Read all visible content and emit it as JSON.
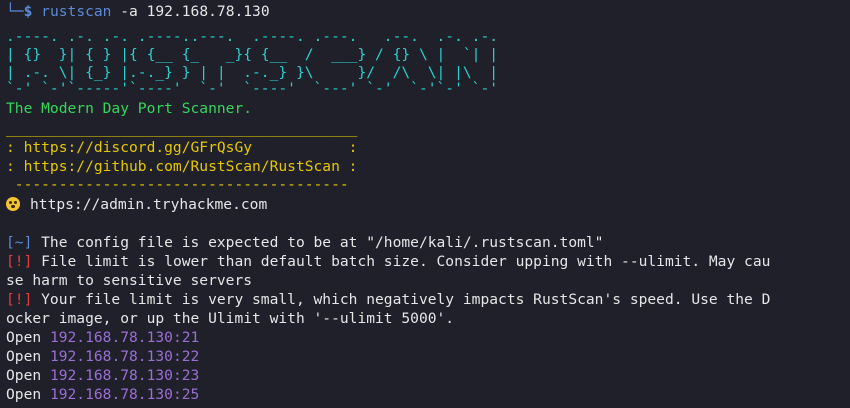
{
  "prompt": {
    "corner": "└─",
    "dollar": "$",
    "command": "rustscan",
    "args": " -a 192.168.78.130"
  },
  "logo": {
    "lines": [
      ".----. .-. .-. .----..---.  .----. .---.   .--.  .-. .-.",
      "| {}  }| { } |{ {__ {_   _}{ {__  /  ___} / {} \\ |  `| |",
      "| .-. \\| {_} |.-._} } | |  .-._} }\\     }/  /\\  \\| |\\  |",
      "`-' `-'`-----'`----'  `-'  `----'  `---' `-'  `-'`-' `-'"
    ]
  },
  "tagline": "The Modern Day Port Scanner.",
  "banner": {
    "top_rule": "________________________________________",
    "discord": ": https://discord.gg/GFrQsGy           :",
    "github": ": https://github.com/RustScan/RustScan :",
    "bottom_rule": " --------------------------------------"
  },
  "admin": {
    "icon": "surprised-face-emoji",
    "text": "https://admin.tryhackme.com"
  },
  "messages": [
    {
      "tag": "[~]",
      "tag_color": "blue",
      "text": " The config file is expected to be at \"/home/kali/.rustscan.toml\""
    },
    {
      "tag": "[!]",
      "tag_color": "red",
      "text": " File limit is lower than default batch size. Consider upping with --ulimit. May cau"
    },
    {
      "tag": "",
      "tag_color": "none",
      "text": "se harm to sensitive servers"
    },
    {
      "tag": "[!]",
      "tag_color": "red",
      "text": " Your file limit is very small, which negatively impacts RustScan's speed. Use the D"
    },
    {
      "tag": "",
      "tag_color": "none",
      "text": "ocker image, or up the Ulimit with '--ulimit 5000'."
    }
  ],
  "open_ports": [
    {
      "label": "Open ",
      "addr": "192.168.78.130:21"
    },
    {
      "label": "Open ",
      "addr": "192.168.78.130:22"
    },
    {
      "label": "Open ",
      "addr": "192.168.78.130:23"
    },
    {
      "label": "Open ",
      "addr": "192.168.78.130:25"
    }
  ],
  "colors": {
    "background": "#1f2029",
    "prompt_blue": "#5b8ad6",
    "logo_cyan": "#2ad1d1",
    "tagline_green": "#36d65d",
    "banner_yellow": "#e6c800",
    "warning_red": "#e53e3e",
    "ip_purple": "#9b6fd4"
  }
}
